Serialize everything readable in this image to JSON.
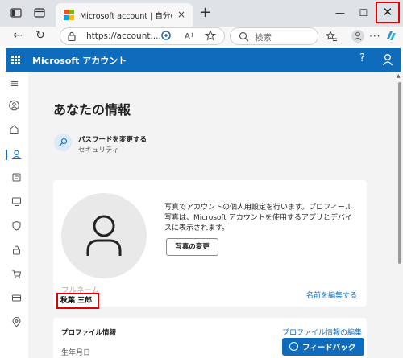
{
  "browser": {
    "tab_title": "Microsoft account | 自分のプロフィール",
    "tab_close": "×",
    "new_tab": "+",
    "minimize": "—",
    "maximize": "☐",
    "close": "✕",
    "back": "←",
    "refresh": "↻",
    "address": "https://account....",
    "search_placeholder": "検索",
    "icons": [
      "sidebar-tabs-icon",
      "workspaces-icon",
      "lock-icon",
      "tracking-icon",
      "read-aloud-icon",
      "favorite-icon",
      "search-icon",
      "favorites-icon",
      "profile-icon",
      "more-icon",
      "copilot-icon"
    ],
    "accent": "#0f6cbd",
    "highlight": "#e00000"
  },
  "header": {
    "title": "Microsoft アカウント",
    "help": "?"
  },
  "rail": {
    "icons": [
      "menu-icon",
      "person-icon",
      "home-icon",
      "your-info-icon",
      "subscriptions-icon",
      "devices-icon",
      "security-icon",
      "privacy-icon",
      "payment-icon",
      "orders-icon",
      "location-icon"
    ]
  },
  "main": {
    "title": "あなたの情報",
    "password": {
      "title": "パスワードを変更する",
      "subtitle": "セキュリティ"
    },
    "photo": {
      "description": "写真でアカウントの個人用設定を行います。プロフィール写真は、Microsoft アカウントを使用するアプリとデバイスに表示されます。",
      "button": "写真の変更"
    },
    "fullname": {
      "label": "フルネーム",
      "value": "秋葉 三郎",
      "edit": "名前を編集する"
    },
    "profile_info": {
      "title": "プロファイル情報",
      "edit": "プロファイル情報の編集",
      "birthdate_label": "生年月日"
    },
    "feedback": "フィードバック"
  }
}
